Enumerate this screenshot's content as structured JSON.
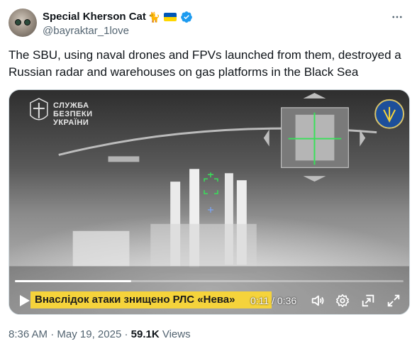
{
  "author": {
    "display_name": "Special Kherson Cat",
    "emoji": "🐈",
    "handle": "@bayraktar_1love",
    "verified": true,
    "icons": [
      "avatar-cat-photo",
      "ukraine-flag-icon",
      "verified-badge-icon",
      "more-options-icon"
    ]
  },
  "tweet": {
    "text": "The SBU, using naval drones and FPVs launched from them, destroyed a Russian radar and warehouses on gas platforms in the Black Sea"
  },
  "video": {
    "overlay_logo_text": "СЛУЖБА\nБЕЗПЕКИ\nУКРАЇНИ",
    "caption": "Внаслідок атаки знищено РЛС «Нева»",
    "current_time": "0:11",
    "separator": " / ",
    "duration": "0:36",
    "progress_fraction": 0.3,
    "icons": [
      "play-icon",
      "volume-icon",
      "settings-gear-icon",
      "picture-in-picture-icon",
      "fullscreen-icon"
    ]
  },
  "meta": {
    "time": "8:36 AM",
    "dot1": " · ",
    "date": "May 19, 2025",
    "dot2": " · ",
    "views_count": "59.1K",
    "views_label": " Views"
  },
  "colors": {
    "text": "#0f1419",
    "secondary": "#536471",
    "verified_blue": "#1d9bf0",
    "caption_yellow": "#f5d33b",
    "flag_blue": "#0057b7",
    "flag_yellow": "#ffd700"
  }
}
